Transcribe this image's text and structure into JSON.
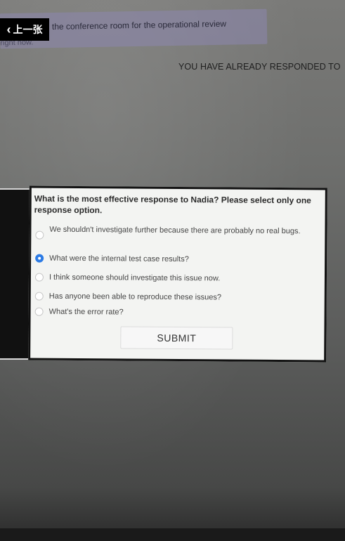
{
  "nav": {
    "back_label": "上一张"
  },
  "banner": {
    "text": "the conference room for the operational review",
    "subtext": "right now."
  },
  "status": {
    "already_responded": "YOU HAVE ALREADY RESPONDED TO"
  },
  "question": {
    "prompt": "What is the most effective response to Nadia? Please select only one response option.",
    "selected_index": 1,
    "options": [
      {
        "label": "We shouldn't investigate further because there are probably no real bugs.",
        "checked": false
      },
      {
        "label": "What were the internal test case results?",
        "checked": true
      },
      {
        "label": "I think someone should investigate this issue now.",
        "checked": false
      },
      {
        "label": "Has anyone been able to reproduce these issues?",
        "checked": false
      },
      {
        "label": "What's the error rate?",
        "checked": false
      }
    ],
    "submit_label": "SUBMIT"
  },
  "colors": {
    "selected_radio": "#2c7be5",
    "banner": "#8c87af"
  }
}
